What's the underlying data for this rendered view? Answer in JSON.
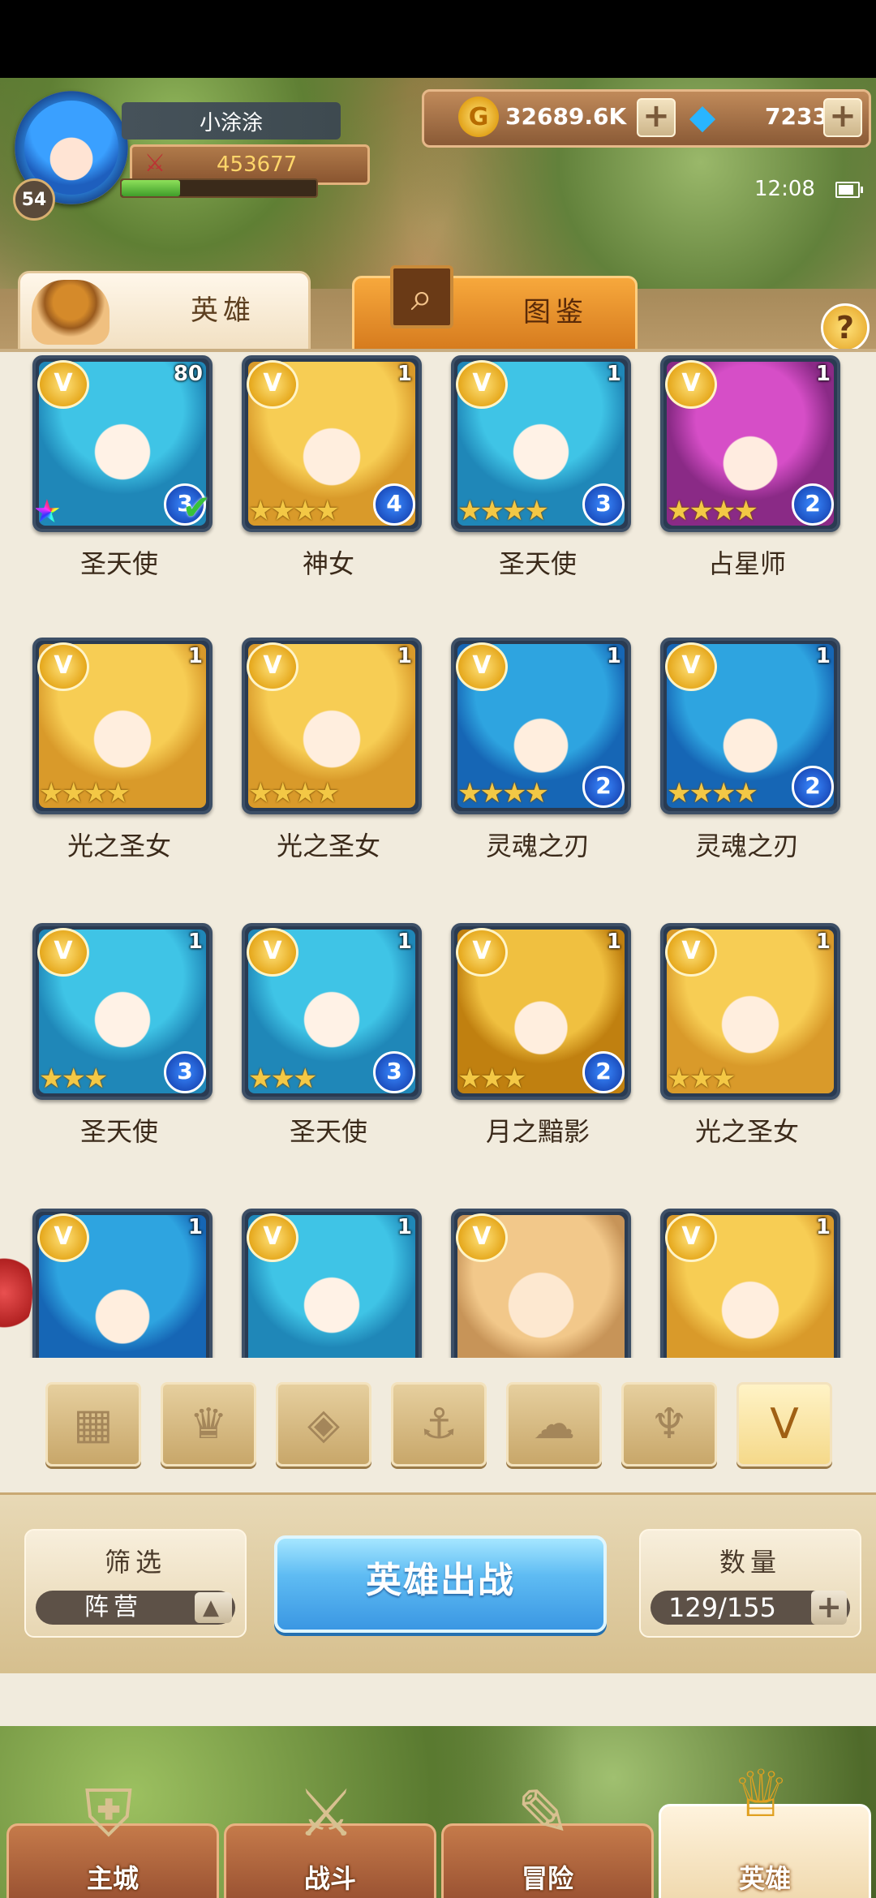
{
  "player": {
    "name": "小涂涂",
    "level": "54",
    "power": "453677",
    "exp_fraction": 0.3
  },
  "currency": {
    "gold": "32689.6K",
    "gems": "7233"
  },
  "status": {
    "time": "12:08",
    "battery_fraction": 0.8
  },
  "tabs": {
    "heroes": "英雄",
    "codex": "图鉴",
    "help": "?"
  },
  "heroes": [
    {
      "name": "圣天使",
      "level": "80",
      "stars": "",
      "rank": "3",
      "portrait": "blue",
      "rainbow": true,
      "check": true
    },
    {
      "name": "神女",
      "level": "1",
      "stars": "★★★★",
      "rank": "4",
      "portrait": "gold"
    },
    {
      "name": "圣天使",
      "level": "1",
      "stars": "★★★★",
      "rank": "3",
      "portrait": "blue"
    },
    {
      "name": "占星师",
      "level": "1",
      "stars": "★★★★",
      "rank": "2",
      "portrait": "pink"
    },
    {
      "name": "光之圣女",
      "level": "1",
      "stars": "★★★★",
      "rank": "",
      "portrait": "gold"
    },
    {
      "name": "光之圣女",
      "level": "1",
      "stars": "★★★★",
      "rank": "",
      "portrait": "gold"
    },
    {
      "name": "灵魂之刃",
      "level": "1",
      "stars": "★★★★",
      "rank": "2",
      "portrait": "cyan-orange"
    },
    {
      "name": "灵魂之刃",
      "level": "1",
      "stars": "★★★★",
      "rank": "2",
      "portrait": "cyan-orange"
    },
    {
      "name": "圣天使",
      "level": "1",
      "stars": "★★★",
      "rank": "3",
      "portrait": "blue"
    },
    {
      "name": "圣天使",
      "level": "1",
      "stars": "★★★",
      "rank": "3",
      "portrait": "blue"
    },
    {
      "name": "月之黯影",
      "level": "1",
      "stars": "★★★",
      "rank": "2",
      "portrait": "purple"
    },
    {
      "name": "光之圣女",
      "level": "1",
      "stars": "★★★",
      "rank": "",
      "portrait": "gold"
    },
    {
      "name": "",
      "level": "1",
      "stars": "",
      "rank": "",
      "portrait": "cyan-orange"
    },
    {
      "name": "",
      "level": "1",
      "stars": "",
      "rank": "",
      "portrait": "blue"
    },
    {
      "name": "",
      "level": "",
      "stars": "",
      "rank": "",
      "portrait": "sepia"
    },
    {
      "name": "",
      "level": "1",
      "stars": "",
      "rank": "",
      "portrait": "gold"
    }
  ],
  "faction_filters": [
    {
      "icon": "grid-icon",
      "glyph": "▦"
    },
    {
      "icon": "crystal-icon",
      "glyph": "♛"
    },
    {
      "icon": "diamond-icon",
      "glyph": "◈"
    },
    {
      "icon": "anchor-icon",
      "glyph": "⚓"
    },
    {
      "icon": "beast-icon",
      "glyph": "☁"
    },
    {
      "icon": "demon-icon",
      "glyph": "♆"
    },
    {
      "icon": "wings-icon",
      "glyph": "V",
      "active": true
    }
  ],
  "controls": {
    "filter_title": "筛选",
    "filter_value": "阵营",
    "deploy": "英雄出战",
    "count_title": "数量",
    "count_value": "129/155"
  },
  "nav": [
    {
      "label": "主城",
      "icon": "castle-icon",
      "glyph": "⛨"
    },
    {
      "label": "战斗",
      "icon": "crossed-swords-icon",
      "glyph": "⚔"
    },
    {
      "label": "冒险",
      "icon": "map-icon",
      "glyph": "✎"
    },
    {
      "label": "英雄",
      "icon": "hero-helmet-icon",
      "glyph": "♕",
      "active": true
    }
  ]
}
